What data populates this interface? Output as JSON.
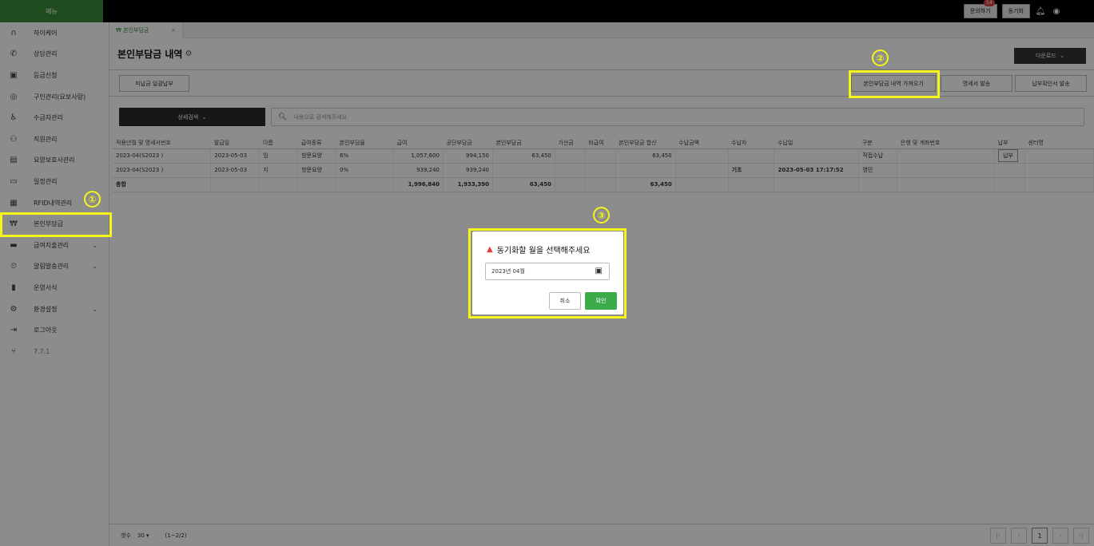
{
  "topbar": {
    "menu_label": "메뉴",
    "inquiry_label": "문의하기",
    "inquiry_badge": "14",
    "sync_label": "동기화"
  },
  "sidebar": {
    "items": [
      {
        "label": "하이케어",
        "icon": "logo-icon"
      },
      {
        "label": "상담관리",
        "icon": "phone-icon"
      },
      {
        "label": "등급신청",
        "icon": "id-card-icon"
      },
      {
        "label": "구인관리(요보사랑)",
        "icon": "signal-icon"
      },
      {
        "label": "수급자관리",
        "icon": "wheelchair-icon"
      },
      {
        "label": "직원관리",
        "icon": "people-icon"
      },
      {
        "label": "요양보호사관리",
        "icon": "badge-icon"
      },
      {
        "label": "일정관리",
        "icon": "calendar-icon"
      },
      {
        "label": "RFID내역관리",
        "icon": "rfid-icon"
      },
      {
        "label": "본인부담금",
        "icon": "won-icon"
      },
      {
        "label": "급여지출관리",
        "icon": "money-icon"
      },
      {
        "label": "알림발송관리",
        "icon": "alarm-icon"
      },
      {
        "label": "운영서식",
        "icon": "document-icon"
      },
      {
        "label": "환경설정",
        "icon": "gear-icon"
      },
      {
        "label": "로그아웃",
        "icon": "logout-icon"
      },
      {
        "label": "7.7.1",
        "icon": "branch-icon"
      }
    ]
  },
  "tab": {
    "label": "본인부담금",
    "close": "×"
  },
  "page": {
    "title": "본인부담금 내역",
    "download_label": "다운로드",
    "unpaid_batch_label": "미납금 일괄납부",
    "fetch_label": "본인부담금 내역 가져오기",
    "statement_label": "명세서 발송",
    "receipt_label": "납부확인서 발송",
    "adv_search_label": "상세검색",
    "search_placeholder": "내용으로 검색해주세요"
  },
  "table": {
    "headers": [
      "적용년월 및 명세서번호",
      "발급일",
      "이름",
      "급여종류",
      "본인부담율",
      "급여",
      "공단부담금",
      "본인부담금",
      "가산금",
      "비급여",
      "본인부담금 합산",
      "수납금액",
      "수납자",
      "수납일",
      "구분",
      "은행 및 계좌번호",
      "납부",
      "센터명"
    ],
    "rows": [
      [
        "2023-04(S2023            )",
        "2023-05-03",
        "임",
        "방문요양",
        "6%",
        "1,057,600",
        "994,150",
        "63,450",
        "",
        "",
        "63,450",
        "",
        "",
        "",
        "직접수납",
        "",
        "납부",
        ""
      ],
      [
        "2023-04(S2023            )",
        "2023-05-03",
        "지",
        "방문요양",
        "0%",
        "939,240",
        "939,240",
        "",
        "",
        "",
        "",
        "",
        "기초",
        "2023-05-03 17:17:52",
        "영민",
        "",
        "",
        ""
      ]
    ],
    "total": [
      "총합",
      "",
      "",
      "",
      "",
      "1,996,840",
      "1,933,390",
      "63,450",
      "",
      "",
      "63,450",
      "",
      "",
      "",
      "",
      "",
      "",
      ""
    ]
  },
  "footer": {
    "count_label": "갯수",
    "page_size": "30 ▾",
    "range": "(1~2/2)",
    "current_page": "1"
  },
  "dialog": {
    "title": "동기화할 월을 선택해주세요",
    "date_value": "2023년 04월",
    "cancel_label": "취소",
    "ok_label": "확인"
  },
  "annotations": [
    "①",
    "②",
    "③"
  ],
  "colors": {
    "accent": "#3b8c3b",
    "highlight": "#f5f51a",
    "ok": "#3daa4a"
  }
}
